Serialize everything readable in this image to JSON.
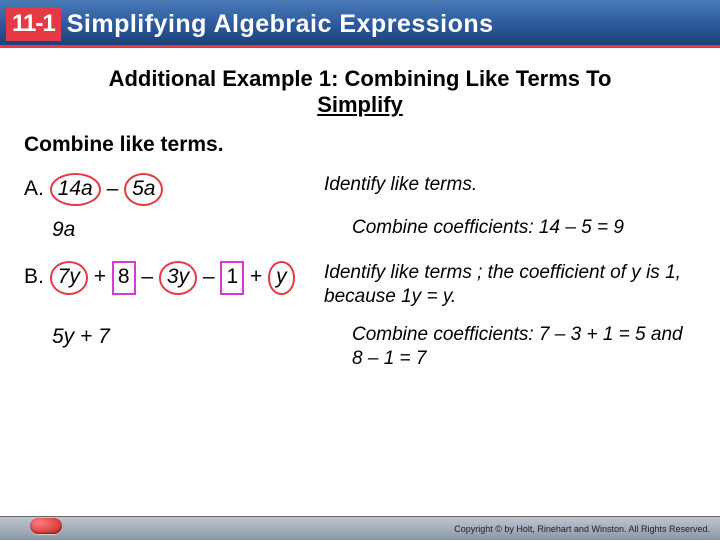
{
  "header": {
    "lesson_number": "11-1",
    "title": "Simplifying Algebraic Expressions"
  },
  "example_title_1": "Additional Example 1: Combining Like Terms To",
  "example_title_2": "Simplify",
  "instruction": "Combine like terms.",
  "partA": {
    "label": "A.",
    "term1": "14a",
    "op": "–",
    "term2": "5a",
    "result": "9a",
    "note1": "Identify like terms.",
    "note2": "Combine coefficients: 14 – 5 = 9"
  },
  "partB": {
    "label": "B.",
    "t1": "7y",
    "p1": "+",
    "t2": "8",
    "p2": "–",
    "t3": "3y",
    "p3": "–",
    "t4": "1",
    "p4": "+",
    "t5": "y",
    "note1": "Identify like terms ; the coefficient of y is 1, because 1y = y.",
    "result": "5y + 7",
    "note2": "Combine coefficients: 7 – 3 + 1 = 5 and 8 – 1 = 7"
  },
  "footer": {
    "copyright": "Copyright © by Holt, Rinehart and Winston. All Rights Reserved."
  }
}
